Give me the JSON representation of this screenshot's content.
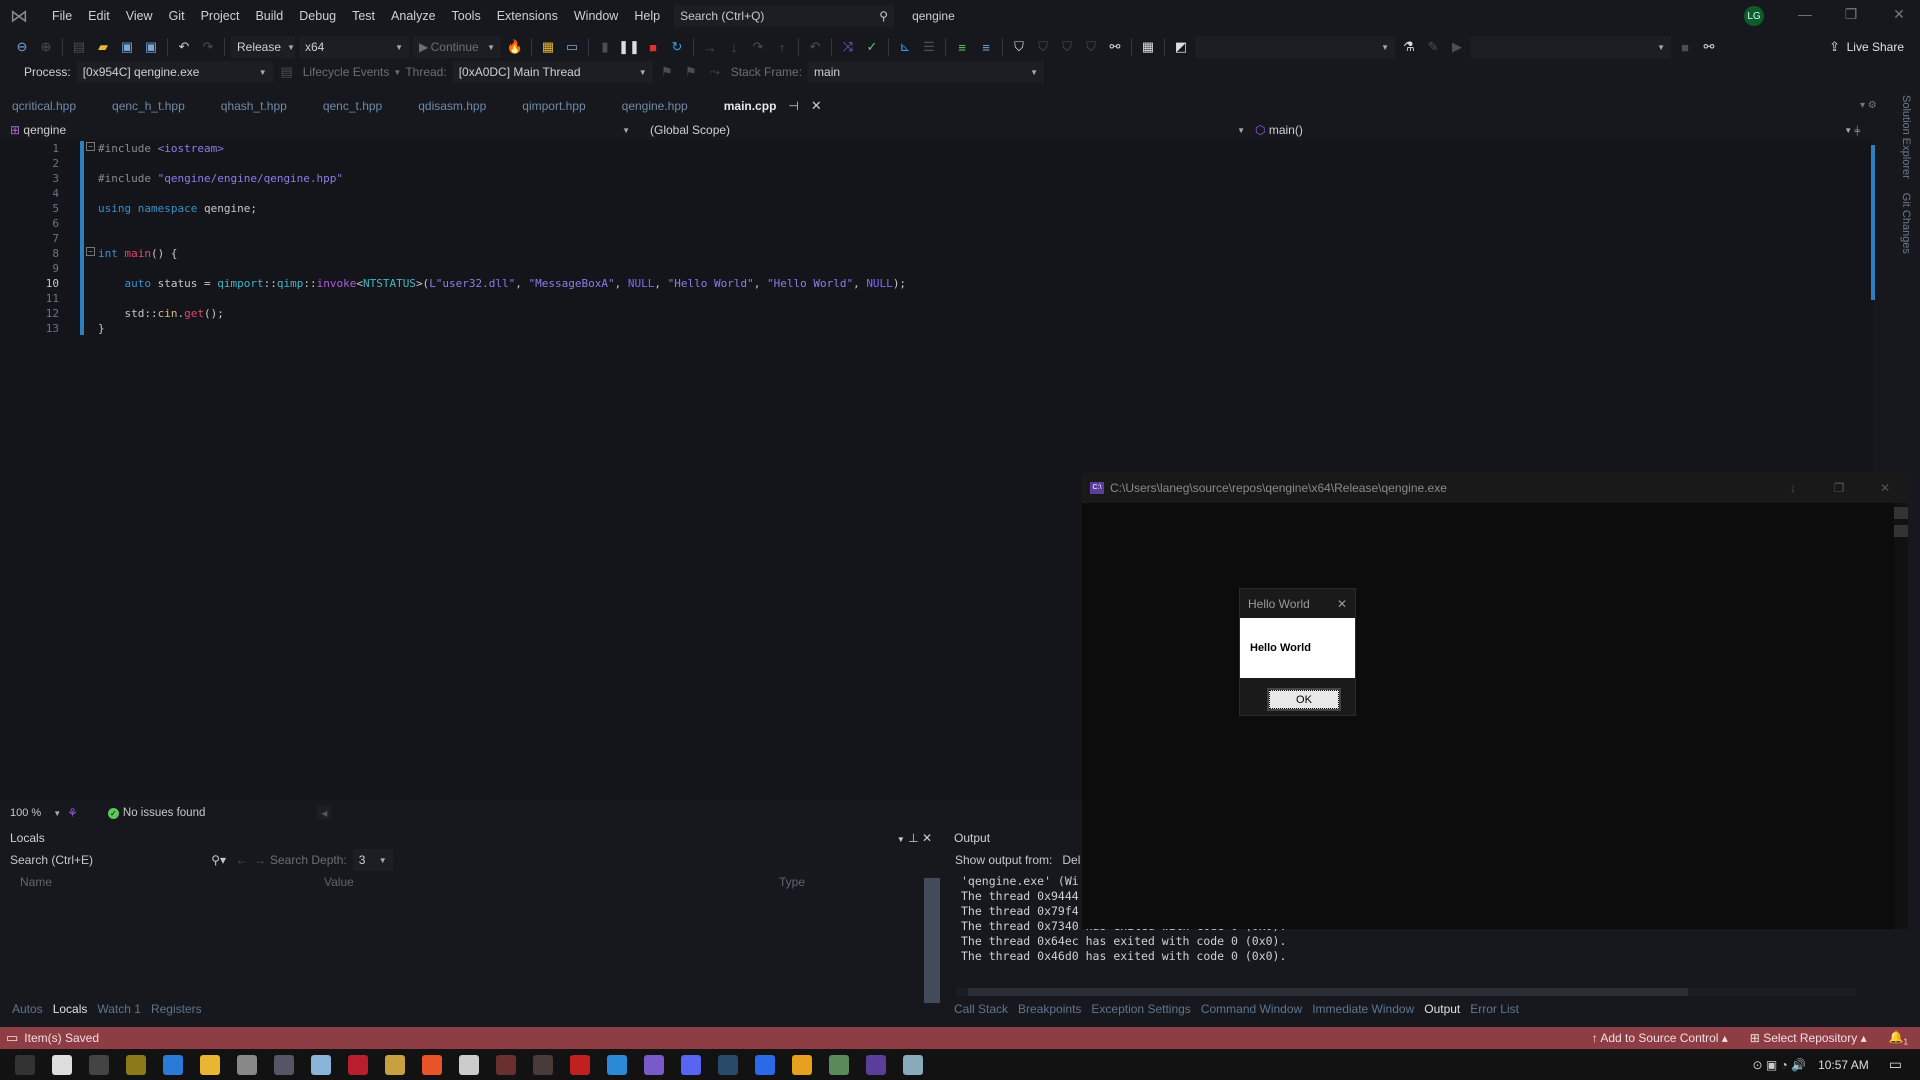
{
  "menubar": {
    "items": [
      "File",
      "Edit",
      "View",
      "Git",
      "Project",
      "Build",
      "Debug",
      "Test",
      "Analyze",
      "Tools",
      "Extensions",
      "Window",
      "Help"
    ],
    "search_placeholder": "Search (Ctrl+Q)",
    "title": "qengine",
    "avatar": "LG"
  },
  "toolbar": {
    "config": "Release",
    "platform": "x64",
    "continue": "Continue",
    "live_share": "Live Share"
  },
  "debugbar": {
    "process_label": "Process:",
    "process": "[0x954C] qengine.exe",
    "lifecycle": "Lifecycle Events",
    "thread_label": "Thread:",
    "thread": "[0xA0DC] Main Thread",
    "stack_label": "Stack Frame:",
    "stack": "main"
  },
  "tabs": [
    {
      "label": "qcritical.hpp"
    },
    {
      "label": "qenc_h_t.hpp"
    },
    {
      "label": "qhash_t.hpp"
    },
    {
      "label": "qenc_t.hpp"
    },
    {
      "label": "qdisasm.hpp"
    },
    {
      "label": "qimport.hpp"
    },
    {
      "label": "qengine.hpp"
    },
    {
      "label": "main.cpp",
      "active": true
    }
  ],
  "navbar": {
    "project": "qengine",
    "scope": "(Global Scope)",
    "member": "main()"
  },
  "side_tabs": [
    "Solution Explorer",
    "Git Changes"
  ],
  "code": [
    [
      [
        "#include ",
        "t-pp"
      ],
      [
        "<iostream>",
        "t-str"
      ]
    ],
    [],
    [
      [
        "#include ",
        "t-pp"
      ],
      [
        "\"qengine/engine/qengine.hpp\"",
        "t-str"
      ]
    ],
    [],
    [
      [
        "using namespace ",
        "t-kw"
      ],
      [
        "qengine;",
        "t-def"
      ]
    ],
    [],
    [],
    [
      [
        "int ",
        "t-kw"
      ],
      [
        "main",
        "t-fn"
      ],
      [
        "() {",
        "t-def"
      ]
    ],
    [],
    [
      [
        "    auto ",
        "t-kw"
      ],
      [
        "status = ",
        "t-def"
      ],
      [
        "qimport",
        "t-ns"
      ],
      [
        "::",
        "t-def"
      ],
      [
        "qimp",
        "t-ns"
      ],
      [
        "::",
        "t-def"
      ],
      [
        "invoke",
        "t-tpl"
      ],
      [
        "<",
        "t-def"
      ],
      [
        "NTSTATUS",
        "t-ns"
      ],
      [
        ">(",
        "t-def"
      ],
      [
        "L\"user32.dll\"",
        "t-str"
      ],
      [
        ", ",
        "t-def"
      ],
      [
        "\"MessageBoxA\"",
        "t-str"
      ],
      [
        ", ",
        "t-def"
      ],
      [
        "NULL",
        "t-null"
      ],
      [
        ", ",
        "t-def"
      ],
      [
        "\"Hello World\"",
        "t-str"
      ],
      [
        ", ",
        "t-def"
      ],
      [
        "\"Hello World\"",
        "t-str"
      ],
      [
        ", ",
        "t-def"
      ],
      [
        "NULL",
        "t-null"
      ],
      [
        ");",
        "t-def"
      ]
    ],
    [],
    [
      [
        "    std::",
        "t-def"
      ],
      [
        "cin",
        "t-yel"
      ],
      [
        ".",
        "t-def"
      ],
      [
        "get",
        "t-fn"
      ],
      [
        "();",
        "t-def"
      ]
    ],
    [
      [
        "}",
        "t-def"
      ]
    ]
  ],
  "current_line": 10,
  "editor_status": {
    "zoom": "100 %",
    "issues": "No issues found"
  },
  "locals": {
    "title": "Locals",
    "search_placeholder": "Search (Ctrl+E)",
    "depth_label": "Search Depth:",
    "depth": "3",
    "columns": [
      "Name",
      "Value",
      "Type"
    ],
    "tabs": [
      "Autos",
      "Locals",
      "Watch 1",
      "Registers"
    ],
    "active_tab": "Locals"
  },
  "output": {
    "title": "Output",
    "from_label": "Show output from:",
    "from_value": "Del",
    "lines": [
      "'qengine.exe' (Wi",
      "The thread 0x9444",
      "The thread 0x79f4",
      "The thread 0x7340 has exited with code 0 (0x0).",
      "The thread 0x64ec has exited with code 0 (0x0).",
      "The thread 0x46d0 has exited with code 0 (0x0)."
    ],
    "tabs": [
      "Call Stack",
      "Breakpoints",
      "Exception Settings",
      "Command Window",
      "Immediate Window",
      "Output",
      "Error List"
    ],
    "active_tab": "Output"
  },
  "console": {
    "title": "C:\\Users\\laneg\\source\\repos\\qengine\\x64\\Release\\qengine.exe",
    "icon_text": "C:\\"
  },
  "msgbox": {
    "title": "Hello World",
    "text": "Hello World",
    "ok": "OK"
  },
  "statusbar": {
    "message": "Item(s) Saved",
    "source_control": "Add to Source Control",
    "repo": "Select Repository",
    "notifications": "1",
    "color": "#8f3d45"
  },
  "taskbar": {
    "time": "10:57 AM",
    "icons": [
      {
        "name": "cortana",
        "color": "#333"
      },
      {
        "name": "settings",
        "color": "#ddd"
      },
      {
        "name": "terminal",
        "color": "#444"
      },
      {
        "name": "m-app",
        "color": "#8a7a1a"
      },
      {
        "name": "store",
        "color": "#2a7ad8"
      },
      {
        "name": "file-explorer",
        "color": "#e8b632"
      },
      {
        "name": "task-monitor",
        "color": "#888"
      },
      {
        "name": "calculator",
        "color": "#556"
      },
      {
        "name": "notepad",
        "color": "#8ab4d8"
      },
      {
        "name": "t-app",
        "color": "#b81e2e"
      },
      {
        "name": "hxd",
        "color": "#c8a040"
      },
      {
        "name": "burp",
        "color": "#e8532a"
      },
      {
        "name": "windows-copy",
        "color": "#ccc"
      },
      {
        "name": "person-app",
        "color": "#6a3030"
      },
      {
        "name": "s-app",
        "color": "#4a3a3a"
      },
      {
        "name": "red-app",
        "color": "#c02020"
      },
      {
        "name": "vscode",
        "color": "#2a8ad8"
      },
      {
        "name": "visual-studio",
        "color": "#7a5ac8"
      },
      {
        "name": "discord",
        "color": "#5865f2"
      },
      {
        "name": "steam",
        "color": "#2a4a6a"
      },
      {
        "name": "firefox",
        "color": "#2a6ae8"
      },
      {
        "name": "chrome",
        "color": "#e8a020"
      },
      {
        "name": "perfmon",
        "color": "#5a8a5a"
      },
      {
        "name": "console",
        "color": "#5b3d9b"
      },
      {
        "name": "active-window",
        "color": "#8ab"
      }
    ]
  }
}
